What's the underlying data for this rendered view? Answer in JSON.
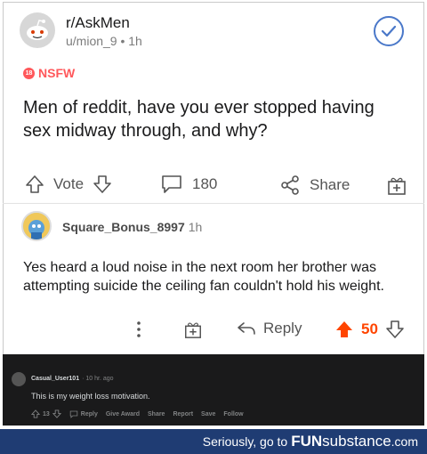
{
  "post": {
    "subreddit": "r/AskMen",
    "user_meta": "u/mion_9 • 1h",
    "nsfw_label": "NSFW",
    "nsfw_badge": "18",
    "title": "Men of reddit, have you ever stopped having sex midway through, and why?",
    "vote_label": "Vote",
    "comment_count": "180",
    "share_label": "Share"
  },
  "comment": {
    "username": "Square_Bonus_8997",
    "time": "1h",
    "text": "Yes heard a loud noise in the next room her brother was attempting suicide the ceiling fan couldn't hold his weight.",
    "reply_label": "Reply",
    "score": "50"
  },
  "reply": {
    "username": "Casual_User101",
    "time": "· 10 hr. ago",
    "text": "This is my weight loss motivation.",
    "score": "13",
    "actions": [
      "Reply",
      "Give Award",
      "Share",
      "Report",
      "Save",
      "Follow"
    ]
  },
  "footer": {
    "prefix": "Seriously, go to",
    "brand_fun": "FUN",
    "brand_substance": "substance",
    "brand_tld": ".com"
  },
  "colors": {
    "nsfw": "#ff585b",
    "upvote": "#ff4500",
    "check": "#4a78c9",
    "footer_bg": "#1f3c73"
  }
}
